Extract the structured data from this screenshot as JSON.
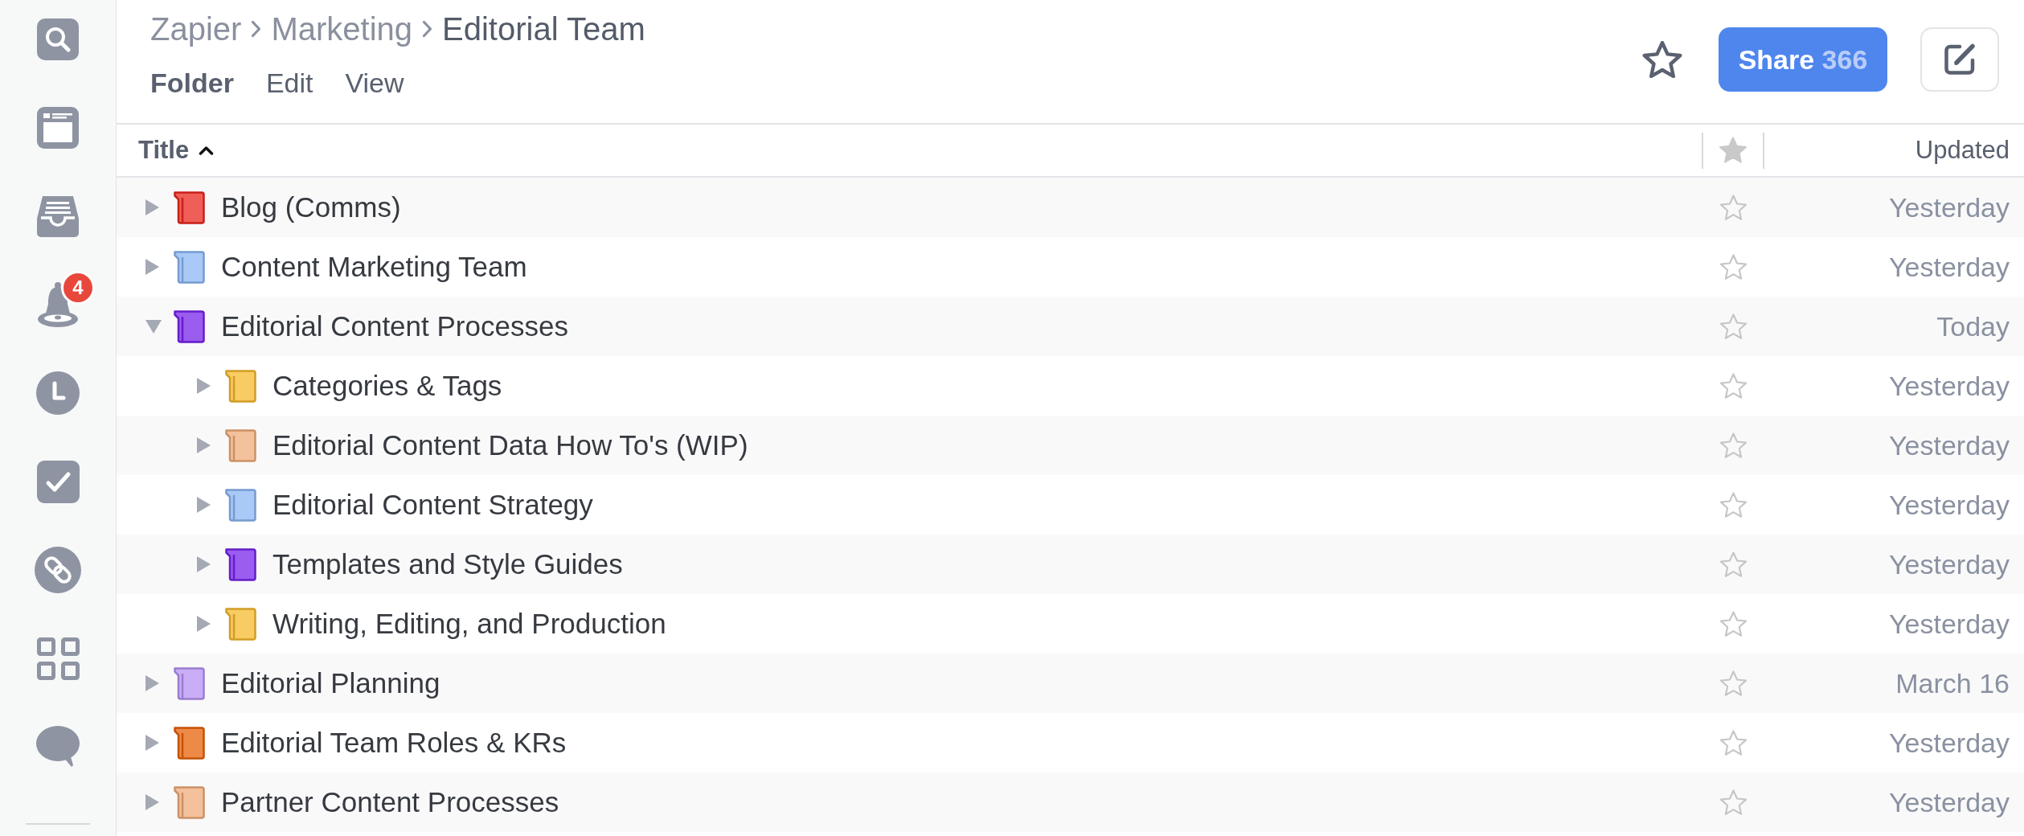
{
  "sidebar": {
    "notification_badge": "4"
  },
  "header": {
    "breadcrumb": [
      "Zapier",
      "Marketing",
      "Editorial Team"
    ],
    "menu": [
      {
        "label": "Folder",
        "selected": true
      },
      {
        "label": "Edit",
        "selected": false
      },
      {
        "label": "View",
        "selected": false
      }
    ],
    "starred": false,
    "share": {
      "label": "Share",
      "count": "366"
    }
  },
  "table": {
    "columns": {
      "title": {
        "label": "Title",
        "sorted_ascending": true
      },
      "updated": {
        "label": "Updated"
      }
    },
    "rows": [
      {
        "title": "Blog (Comms)",
        "color": "#ef5f58",
        "expanded": false,
        "starred": false,
        "updated": "Yesterday"
      },
      {
        "title": "Content Marketing Team",
        "color": "#a9c9f7",
        "expanded": false,
        "starred": false,
        "updated": "Yesterday"
      },
      {
        "title": "Editorial Content Processes",
        "color": "#9b5cf0",
        "expanded": true,
        "starred": false,
        "updated": "Today",
        "children": [
          {
            "title": "Categories & Tags",
            "color": "#f8cb63",
            "expanded": false,
            "starred": false,
            "updated": "Yesterday"
          },
          {
            "title": "Editorial Content Data How To's (WIP)",
            "color": "#f3c19b",
            "expanded": false,
            "starred": false,
            "updated": "Yesterday"
          },
          {
            "title": "Editorial Content Strategy",
            "color": "#a9c9f7",
            "expanded": false,
            "starred": false,
            "updated": "Yesterday"
          },
          {
            "title": "Templates and Style Guides",
            "color": "#9b5cf0",
            "expanded": false,
            "starred": false,
            "updated": "Yesterday"
          },
          {
            "title": "Writing, Editing, and Production",
            "color": "#f8cb63",
            "expanded": false,
            "starred": false,
            "updated": "Yesterday"
          }
        ]
      },
      {
        "title": "Editorial Planning",
        "color": "#c9aef7",
        "expanded": false,
        "starred": false,
        "updated": "March 16"
      },
      {
        "title": "Editorial Team Roles & KRs",
        "color": "#ed8a47",
        "expanded": false,
        "starred": false,
        "updated": "Yesterday"
      },
      {
        "title": "Partner Content Processes",
        "color": "#f3c19b",
        "expanded": false,
        "starred": false,
        "updated": "Yesterday"
      }
    ]
  }
}
